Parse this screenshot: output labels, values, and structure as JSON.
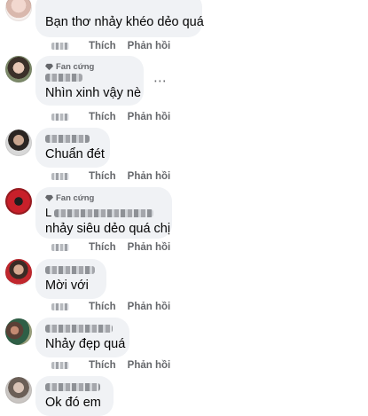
{
  "actions": {
    "like": "Thích",
    "reply": "Phản hồi"
  },
  "fan_badge": "Fan cứng",
  "more_icon": "⋯",
  "comments": [
    {
      "text": "Bạn thơ nhảy khéo dẻo quá",
      "avatar": "avatar-woman-light"
    },
    {
      "text": "Nhìn xinh vậy nè",
      "avatar": "avatar-woman-dark"
    },
    {
      "text": "Chuẩn đét",
      "avatar": "avatar-man-dark"
    },
    {
      "line1": "L",
      "text": "nhảy siêu dẻo quá chị",
      "avatar": "avatar-helmet-red"
    },
    {
      "text": "Mời với",
      "avatar": "avatar-man-red"
    },
    {
      "text": "Nhảy đẹp quá",
      "avatar": "avatar-couple"
    },
    {
      "text": "Ok đó em",
      "avatar": "avatar-woman-gray"
    }
  ],
  "colors": {
    "bubble": "#f0f2f5",
    "meta": "#65676b",
    "text": "#050505"
  }
}
